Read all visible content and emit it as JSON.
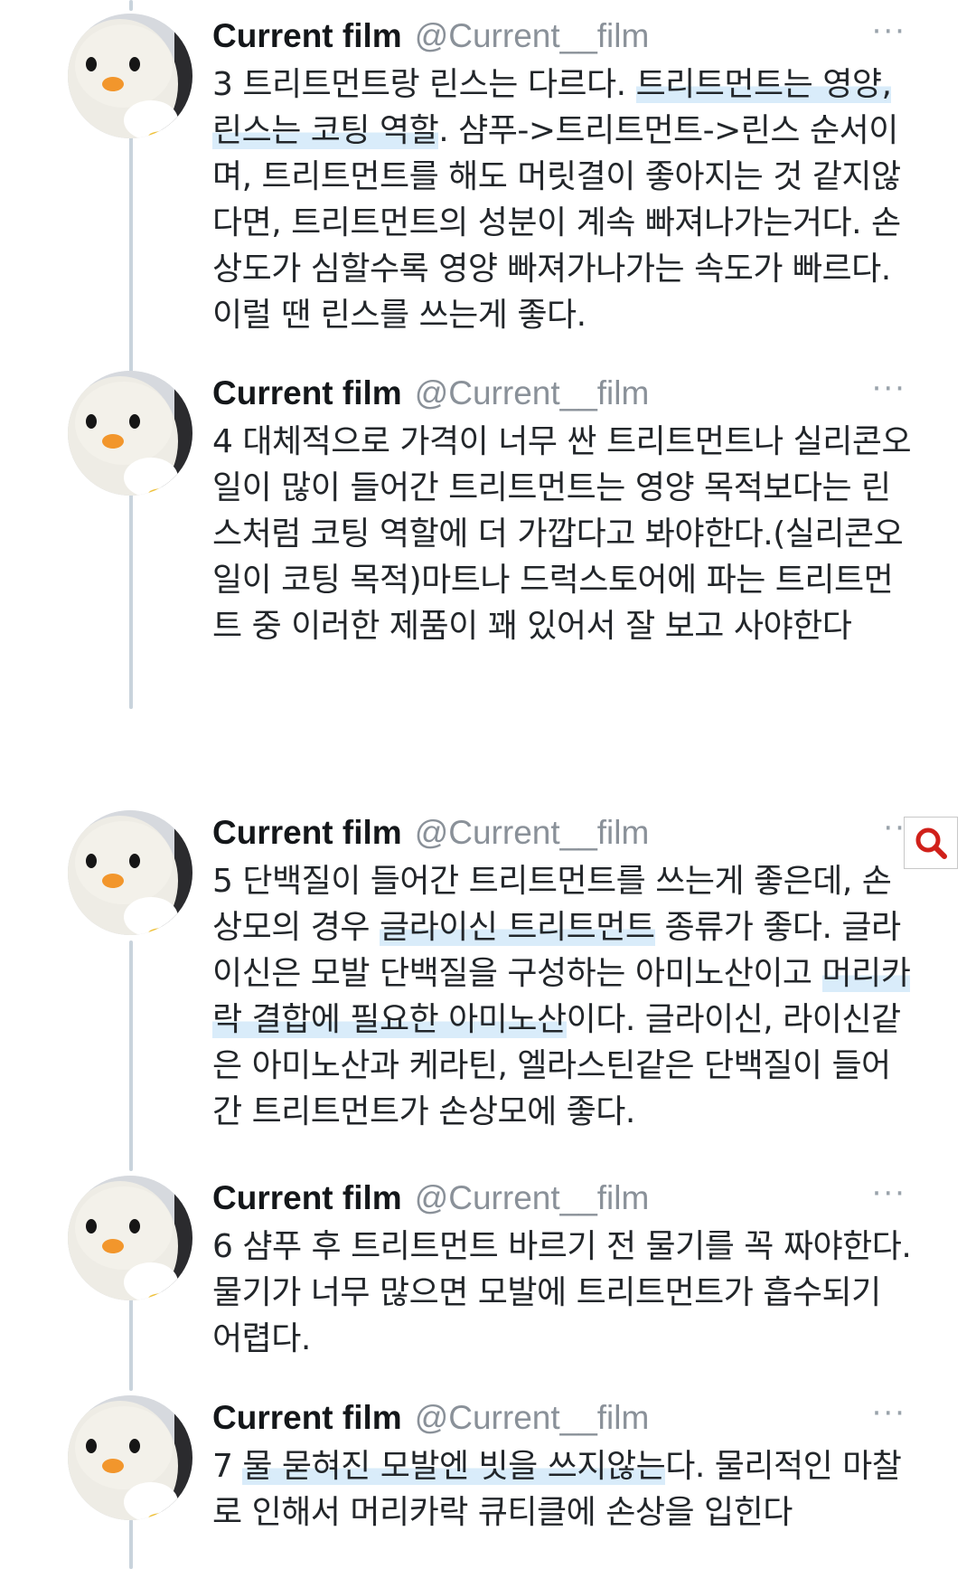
{
  "tweets": [
    {
      "name": "Current film",
      "handle": "@Current__film",
      "more": "···",
      "segments": [
        {
          "t": "3 트리트먼트랑 린스는 다르다. ",
          "h": false
        },
        {
          "t": "트리트먼트는 영양, 린스는 코팅 역할",
          "h": true
        },
        {
          "t": ". 샴푸->트리트먼트->린스 순서이며, 트리트먼트를 해도 머릿결이 좋아지는 것 같지않다면, 트리트먼트의 성분이 계속 빠져나가는거다. 손상도가 심할수록 영양 빠져가나가는 속도가 빠르다. 이럴 땐 린스를 쓰는게 좋다.",
          "h": false
        }
      ]
    },
    {
      "name": "Current film",
      "handle": "@Current__film",
      "more": "···",
      "segments": [
        {
          "t": "4 대체적으로 가격이 너무 싼 트리트먼트나 실리콘오일이 많이 들어간 트리트먼트는 영양 목적보다는 린스처럼 코팅 역할에 더 가깝다고 봐야한다.(실리콘오일이 코팅 목적)마트나 드럭스토어에 파는 트리트먼트 중 이러한 제품이 꽤 있어서 잘 보고 사야한다",
          "h": false
        }
      ]
    },
    {
      "name": "Current film",
      "handle": "@Current__film",
      "more": "··",
      "segments": [
        {
          "t": "5 단백질이 들어간 트리트먼트를 쓰는게 좋은데, 손상모의 경우 ",
          "h": false
        },
        {
          "t": "글라이신 트리트먼트",
          "h": true
        },
        {
          "t": " 종류가 좋다. 글라이신은 모발 단백질을 구성하는 아미노산이고 ",
          "h": false
        },
        {
          "t": "머리카락 결합에 필요한 아미노산",
          "h": true
        },
        {
          "t": "이다. 글라이신, 라이신같은 아미노산과 케라틴, 엘라스틴같은 단백질이 들어간 트리트먼트가 손상모에 좋다.",
          "h": false
        }
      ]
    },
    {
      "name": "Current film",
      "handle": "@Current__film",
      "more": "···",
      "segments": [
        {
          "t": "6 샴푸 후 트리트먼트 바르기 전 물기를 꼭 짜야한다. 물기가 너무 많으면 모발에 트리트먼트가 흡수되기 어렵다.",
          "h": false
        }
      ]
    },
    {
      "name": "Current film",
      "handle": "@Current__film",
      "more": "···",
      "segments": [
        {
          "t": "7 ",
          "h": false
        },
        {
          "t": "물 묻혀진 모발엔 빗을 쓰지않는",
          "h": true
        },
        {
          "t": "다. 물리적인 마찰로 인해서 머리카락 큐티클에 손상을 입힌다",
          "h": false
        }
      ]
    }
  ],
  "icons": {
    "avatar": "penguin-avatar-icon",
    "more": "more-options-icon",
    "search": "search-icon"
  },
  "colors": {
    "highlight": "#d9ecfa",
    "thread_line": "#c9d3dc",
    "handle": "#8a9199",
    "search_icon": "#d0201a"
  }
}
